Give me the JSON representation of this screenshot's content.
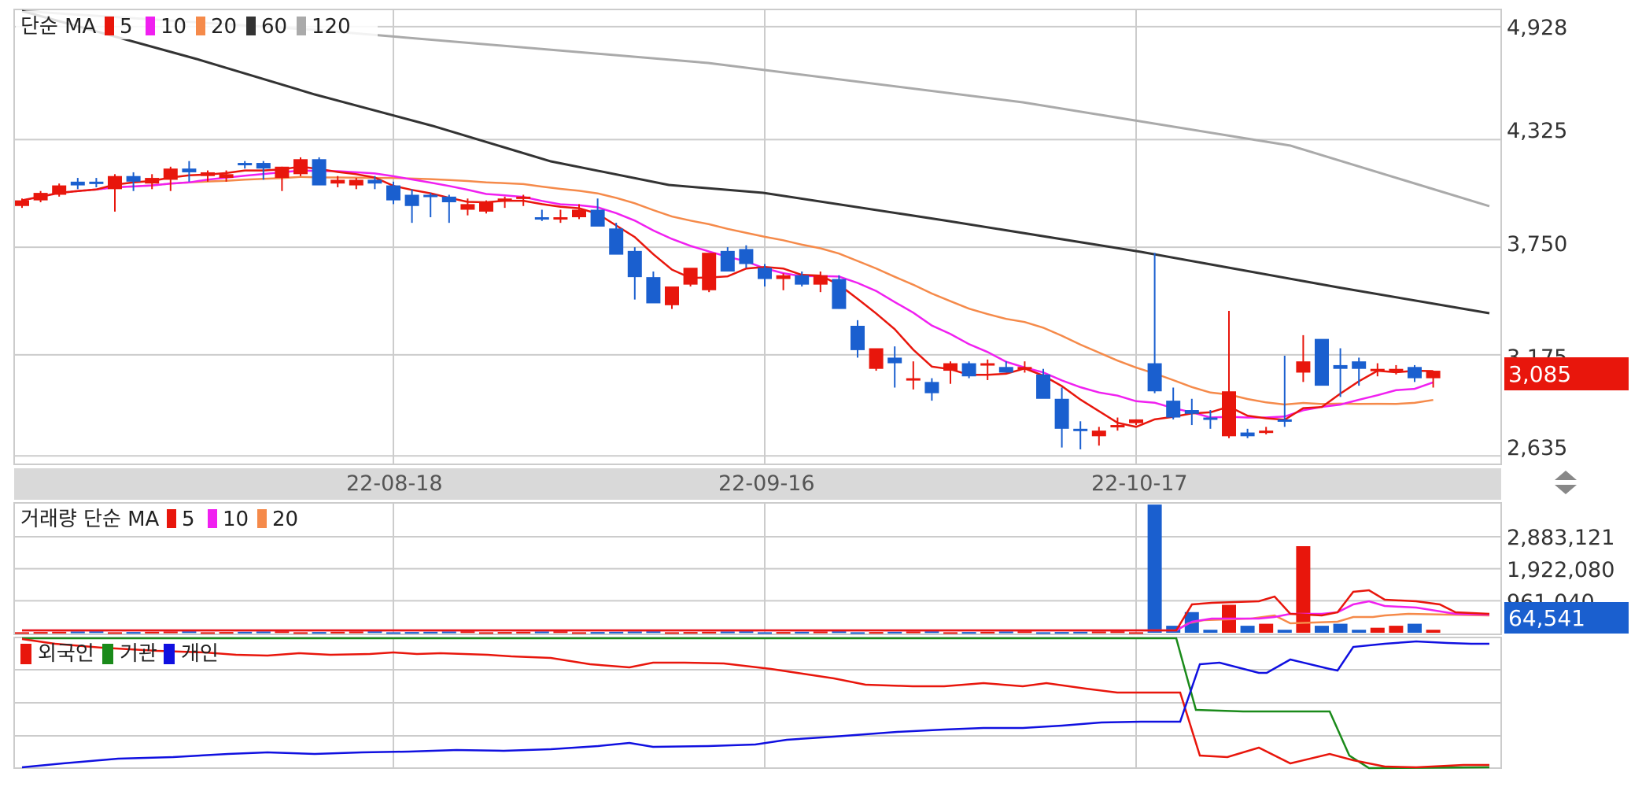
{
  "colors": {
    "up": "#e8160c",
    "down": "#1a5fcf",
    "ma5": "#e8160c",
    "ma10": "#f020f0",
    "ma20": "#f58a4a",
    "ma60": "#333333",
    "ma120": "#aaaaaa",
    "foreign": "#e8160c",
    "institution": "#1a8a1a",
    "individual": "#1010e0",
    "price_badge": "#e8160c",
    "volume_badge": "#1a5fcf"
  },
  "price_panel": {
    "legend_title": "단순 MA",
    "legend": [
      {
        "label": "5",
        "color": "#e8160c"
      },
      {
        "label": "10",
        "color": "#f020f0"
      },
      {
        "label": "20",
        "color": "#f58a4a"
      },
      {
        "label": "60",
        "color": "#333333"
      },
      {
        "label": "120",
        "color": "#aaaaaa"
      }
    ],
    "y_ticks": [
      "4,928",
      "4,325",
      "3,750",
      "3,175",
      "2,635"
    ],
    "current_price": "3,085"
  },
  "date_bar": {
    "labels": [
      "22-08-18",
      "22-09-16",
      "22-10-17"
    ],
    "resize_icon": "up-down-arrows-icon"
  },
  "volume_panel": {
    "legend_title": "거래량 단순 MA",
    "legend": [
      {
        "label": "5",
        "color": "#e8160c"
      },
      {
        "label": "10",
        "color": "#f020f0"
      },
      {
        "label": "20",
        "color": "#f58a4a"
      }
    ],
    "y_ticks": [
      "2,883,121",
      "1,922,080",
      "961,040"
    ],
    "current_volume": "64,541"
  },
  "investor_panel": {
    "legend": [
      {
        "label": "외국인",
        "color": "#e8160c"
      },
      {
        "label": "기관",
        "color": "#1a8a1a"
      },
      {
        "label": "개인",
        "color": "#1010e0"
      }
    ]
  },
  "chart_data": {
    "type": "candlestick",
    "price_axis": {
      "min": 2590,
      "max": 5020,
      "ticks": [
        4928,
        4325,
        3750,
        3175,
        2635
      ]
    },
    "volume_axis": {
      "min": 0,
      "max": 3900000,
      "ticks": [
        2883121,
        1922080,
        961040
      ]
    },
    "dates": [
      {
        "index": 20,
        "label": "22-08-18"
      },
      {
        "index": 40,
        "label": "22-09-16"
      },
      {
        "index": 60,
        "label": "22-10-17"
      }
    ],
    "candles": [
      [
        3970,
        4010,
        3960,
        4000
      ],
      [
        4000,
        4050,
        3990,
        4040
      ],
      [
        4030,
        4090,
        4020,
        4080
      ],
      [
        4100,
        4120,
        4060,
        4080
      ],
      [
        4100,
        4120,
        4070,
        4090
      ],
      [
        4060,
        4140,
        3940,
        4130
      ],
      [
        4130,
        4150,
        4050,
        4100
      ],
      [
        4090,
        4140,
        4060,
        4120
      ],
      [
        4110,
        4180,
        4050,
        4170
      ],
      [
        4170,
        4210,
        4100,
        4150
      ],
      [
        4130,
        4160,
        4100,
        4150
      ],
      [
        4120,
        4160,
        4100,
        4140
      ],
      [
        4200,
        4210,
        4170,
        4190
      ],
      [
        4200,
        4210,
        4110,
        4170
      ],
      [
        4120,
        4180,
        4050,
        4180
      ],
      [
        4140,
        4230,
        4130,
        4220
      ],
      [
        4220,
        4230,
        4090,
        4080
      ],
      [
        4090,
        4130,
        4070,
        4110
      ],
      [
        4080,
        4120,
        4060,
        4110
      ],
      [
        4110,
        4130,
        4060,
        4090
      ],
      [
        4080,
        4100,
        3980,
        4000
      ],
      [
        4030,
        4060,
        3880,
        3970
      ],
      [
        4030,
        4040,
        3910,
        4020
      ],
      [
        4020,
        4030,
        3880,
        3990
      ],
      [
        3950,
        4010,
        3920,
        3980
      ],
      [
        3940,
        4000,
        3930,
        3990
      ],
      [
        4000,
        4020,
        3960,
        4010
      ],
      [
        4010,
        4030,
        3970,
        4020
      ],
      [
        3910,
        3950,
        3890,
        3900
      ],
      [
        3910,
        3950,
        3880,
        3910
      ],
      [
        3910,
        3980,
        3900,
        3950
      ],
      [
        3950,
        4010,
        3880,
        3860
      ],
      [
        3850,
        3880,
        3840,
        3710
      ],
      [
        3730,
        3750,
        3470,
        3590
      ],
      [
        3590,
        3620,
        3470,
        3450
      ],
      [
        3440,
        3480,
        3420,
        3540
      ],
      [
        3550,
        3630,
        3540,
        3640
      ],
      [
        3520,
        3650,
        3510,
        3720
      ],
      [
        3730,
        3750,
        3640,
        3620
      ],
      [
        3740,
        3760,
        3640,
        3660
      ],
      [
        3640,
        3660,
        3540,
        3580
      ],
      [
        3580,
        3610,
        3520,
        3600
      ],
      [
        3600,
        3620,
        3540,
        3550
      ],
      [
        3550,
        3620,
        3510,
        3600
      ],
      [
        3580,
        3600,
        3420,
        3420
      ],
      [
        3330,
        3360,
        3160,
        3200
      ],
      [
        3100,
        3200,
        3090,
        3210
      ],
      [
        3160,
        3220,
        3000,
        3130
      ],
      [
        3040,
        3140,
        2990,
        3050
      ],
      [
        3030,
        3050,
        2930,
        2970
      ],
      [
        3090,
        3140,
        3020,
        3130
      ],
      [
        3130,
        3140,
        3050,
        3060
      ],
      [
        3120,
        3150,
        3040,
        3130
      ],
      [
        3110,
        3140,
        3080,
        3080
      ],
      [
        3110,
        3140,
        3080,
        3110
      ],
      [
        3070,
        3100,
        2950,
        2940
      ],
      [
        2940,
        3000,
        2680,
        2780
      ],
      [
        2780,
        2820,
        2670,
        2770
      ],
      [
        2740,
        2790,
        2690,
        2770
      ],
      [
        2790,
        2840,
        2770,
        2800
      ],
      [
        2810,
        2830,
        2800,
        2830
      ],
      [
        3130,
        3720,
        2970,
        2980
      ],
      [
        2930,
        3000,
        2830,
        2840
      ],
      [
        2880,
        2940,
        2800,
        2860
      ],
      [
        2840,
        2880,
        2780,
        2830
      ],
      [
        2740,
        3410,
        2730,
        2980
      ],
      [
        2760,
        2780,
        2730,
        2740
      ],
      [
        2760,
        2790,
        2750,
        2770
      ],
      [
        2830,
        3170,
        2790,
        2820
      ],
      [
        3080,
        3280,
        3030,
        3140
      ],
      [
        3260,
        3240,
        3110,
        3010
      ],
      [
        3120,
        3210,
        2950,
        3100
      ],
      [
        3140,
        3160,
        3010,
        3100
      ],
      [
        3090,
        3130,
        3060,
        3100
      ],
      [
        3090,
        3120,
        3070,
        3100
      ],
      [
        3110,
        3120,
        3030,
        3050
      ],
      [
        3050,
        3090,
        3000,
        3090
      ]
    ],
    "volume_spikes": [
      [
        61,
        3850000
      ],
      [
        63,
        620000
      ],
      [
        65,
        840000
      ],
      [
        69,
        2600000
      ]
    ]
  }
}
